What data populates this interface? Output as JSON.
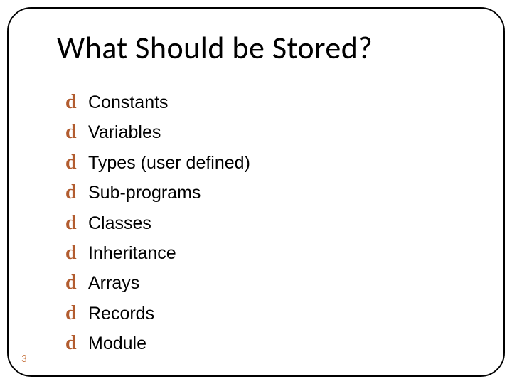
{
  "title": "What Should be Stored?",
  "bullet_glyph": "d",
  "items": [
    "Constants",
    "Variables",
    "Types (user defined)",
    "Sub-programs",
    "Classes",
    "Inheritance",
    "Arrays",
    "Records",
    "Module"
  ],
  "page_number": "3"
}
